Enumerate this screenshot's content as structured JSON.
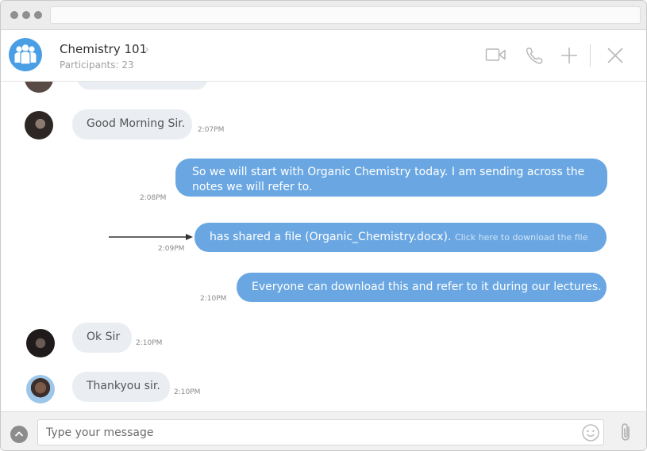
{
  "header": {
    "title": "Chemistry 101",
    "participants": "Participants: 23"
  },
  "messages": [
    {
      "text": "Good Morning Sir.",
      "time": "2:07PM"
    },
    {
      "text": "So we will start with Organic Chemistry today. I am sending across the notes we will refer to.",
      "time": "2:08PM"
    },
    {
      "text": "has shared a file (Organic_Chemistry.docx).",
      "link": "Click here to download the file",
      "time": "2:09PM"
    },
    {
      "text": "Everyone can download this and refer to it during our lectures.",
      "time": "2:10PM"
    },
    {
      "text": "Ok Sir",
      "time": "2:10PM"
    },
    {
      "text": "Thankyou sir.",
      "time": "2:10PM"
    }
  ],
  "composer": {
    "placeholder": "Type your message"
  },
  "colors": {
    "accent": "#4a9ee5",
    "outgoing_bubble": "#6aa7e2",
    "incoming_bubble": "#eaeef3"
  }
}
